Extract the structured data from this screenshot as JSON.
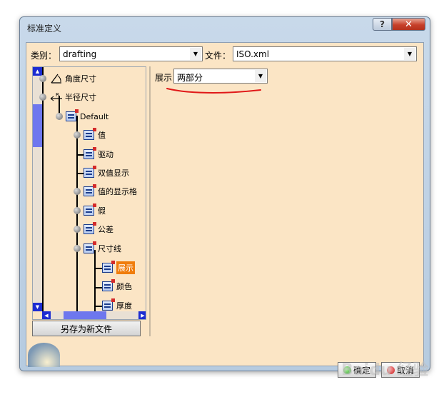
{
  "window": {
    "title": "标准定义",
    "help_glyph": "?",
    "close_glyph": "✕"
  },
  "category": {
    "label": "类别：",
    "value": "drafting"
  },
  "file": {
    "label": "文件：",
    "value": "ISO.xml"
  },
  "tree": {
    "items": [
      {
        "label": "角度尺寸"
      },
      {
        "label": "半径尺寸"
      },
      {
        "label": "Default"
      },
      {
        "label": "值"
      },
      {
        "label": "驱动"
      },
      {
        "label": "双值显示"
      },
      {
        "label": "值的显示格"
      },
      {
        "label": "假"
      },
      {
        "label": "公差"
      },
      {
        "label": "尺寸线"
      },
      {
        "label": "展示",
        "selected": true
      },
      {
        "label": "颜色"
      },
      {
        "label": "厚度"
      }
    ]
  },
  "save_as_button": "另存为新文件",
  "display": {
    "label": "展示",
    "value": "两部分"
  },
  "ok_button": "确定",
  "cancel_button": "取消",
  "watermark": "Baidu 经验",
  "colors": {
    "selection": "#f07d0c",
    "annotation": "#e01818",
    "client_bg": "#fbe5c5"
  }
}
